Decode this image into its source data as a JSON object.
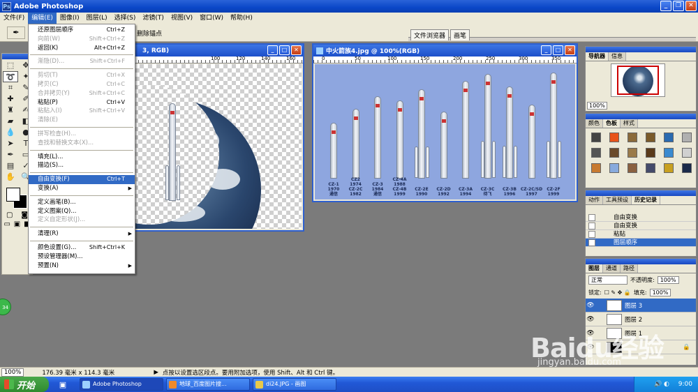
{
  "app": {
    "title": "Adobe Photoshop"
  },
  "menubar": [
    "文件(F)",
    "编辑(E)",
    "图像(I)",
    "图层(L)",
    "选择(S)",
    "滤镜(T)",
    "视图(V)",
    "窗口(W)",
    "帮助(H)"
  ],
  "options": {
    "text": "删除锚点",
    "wells": [
      "文件浏览器",
      "画笔"
    ]
  },
  "edit_menu": [
    {
      "label": "还原图层顺序",
      "shortcut": "Ctrl+Z",
      "state": "normal"
    },
    {
      "label": "向前(W)",
      "shortcut": "Shift+Ctrl+Z",
      "state": "disabled"
    },
    {
      "label": "返回(K)",
      "shortcut": "Alt+Ctrl+Z",
      "state": "normal"
    },
    {
      "label": "---"
    },
    {
      "label": "渐隐(D)...",
      "shortcut": "Shift+Ctrl+F",
      "state": "disabled"
    },
    {
      "label": "---"
    },
    {
      "label": "剪切(T)",
      "shortcut": "Ctrl+X",
      "state": "disabled"
    },
    {
      "label": "拷贝(C)",
      "shortcut": "Ctrl+C",
      "state": "disabled"
    },
    {
      "label": "合并拷贝(Y)",
      "shortcut": "Shift+Ctrl+C",
      "state": "disabled"
    },
    {
      "label": "粘贴(P)",
      "shortcut": "Ctrl+V",
      "state": "normal"
    },
    {
      "label": "粘贴入(I)",
      "shortcut": "Shift+Ctrl+V",
      "state": "disabled"
    },
    {
      "label": "清除(E)",
      "shortcut": "",
      "state": "disabled"
    },
    {
      "label": "---"
    },
    {
      "label": "拼写检查(H)...",
      "shortcut": "",
      "state": "disabled"
    },
    {
      "label": "查找和替换文本(X)...",
      "shortcut": "",
      "state": "disabled"
    },
    {
      "label": "---"
    },
    {
      "label": "填充(L)...",
      "shortcut": "",
      "state": "normal"
    },
    {
      "label": "描边(S)...",
      "shortcut": "",
      "state": "normal"
    },
    {
      "label": "---"
    },
    {
      "label": "自由变换(F)",
      "shortcut": "Ctrl+T",
      "state": "highlighted"
    },
    {
      "label": "变换(A)",
      "shortcut": "",
      "state": "normal",
      "submenu": true
    },
    {
      "label": "---"
    },
    {
      "label": "定义画笔(B)...",
      "shortcut": "",
      "state": "normal"
    },
    {
      "label": "定义图案(Q)...",
      "shortcut": "",
      "state": "normal"
    },
    {
      "label": "定义自定形状(J)...",
      "shortcut": "",
      "state": "disabled"
    },
    {
      "label": "---"
    },
    {
      "label": "清理(R)",
      "shortcut": "",
      "state": "normal",
      "submenu": true
    },
    {
      "label": "---"
    },
    {
      "label": "颜色设置(G)...",
      "shortcut": "Shift+Ctrl+K",
      "state": "normal"
    },
    {
      "label": "预设管理器(M)...",
      "shortcut": "",
      "state": "normal"
    },
    {
      "label": "预置(N)",
      "shortcut": "",
      "state": "normal",
      "submenu": true
    }
  ],
  "doc1": {
    "title": "3, RGB)",
    "ruler": [
      "100",
      "120",
      "140",
      "160"
    ]
  },
  "doc2": {
    "title": "中火箭族4.jpg @ 100%(RGB)",
    "ruler": [
      "0",
      "50",
      "100",
      "150",
      "200",
      "250",
      "300",
      "350"
    ],
    "rockets": [
      {
        "label": "CZ-1\n1970\n通信"
      },
      {
        "label": "CZ2\n1974\nCZ-2C\n1982"
      },
      {
        "label": "CZ-3\n1984\n通信"
      },
      {
        "label": "CZ-4A\n1988\nCZ-4B\n1999"
      },
      {
        "label": "CZ-2E\n1990"
      },
      {
        "label": "CZ-2D\n1992"
      },
      {
        "label": "CZ-3A\n1994"
      },
      {
        "label": "CZ-3C\n待飞"
      },
      {
        "label": "CZ-3B\n1996"
      },
      {
        "label": "CZ-2C/SD\n1997"
      },
      {
        "label": "CZ-2F\n1999"
      }
    ]
  },
  "navigator": {
    "tabs": [
      "导航器",
      "信息"
    ],
    "zoom": "100%"
  },
  "swatches": {
    "tabs": [
      "颜色",
      "色板",
      "样式"
    ],
    "colors": [
      "#444444",
      "#e8531a",
      "#8a6a3a",
      "#7a5a2a",
      "#2a6ab0",
      "#b0b0b0",
      "#555555",
      "#6b4a2a",
      "#9a7a4a",
      "#5a3a1a",
      "#3a8ad0",
      "#d0d0d0",
      "#c87a30",
      "#88aadd",
      "#8a6040",
      "#444a6a",
      "#c8a020",
      "#1a2a4a"
    ]
  },
  "history": {
    "tabs": [
      "动作",
      "工具预设",
      "历史记录"
    ],
    "items": [
      "自由变换",
      "自由变换",
      "粘贴",
      "图层顺序"
    ]
  },
  "layers": {
    "tabs": [
      "图层",
      "通道",
      "路径"
    ],
    "mode": "正常",
    "opacity_label": "不透明度:",
    "opacity": "100%",
    "lock_label": "锁定:",
    "fill_label": "填充:",
    "fill": "100%",
    "items": [
      "图层 3",
      "图层 2",
      "图层 1"
    ]
  },
  "status": {
    "zoom": "100%",
    "size": "176.39 毫米 x 114.3 毫米",
    "hint": "点按以设置选区段点。要用附加选项，使用 Shift、Alt 和 Ctrl 键。"
  },
  "taskbar": {
    "start": "开始",
    "tasks": [
      "Adobe Photoshop",
      "地球_百度图片搜...",
      "di24.JPG - 画图"
    ],
    "time": "9:00"
  },
  "watermark": {
    "main": "Baidu经验",
    "sub": "jingyan.baidu.com"
  },
  "greenball": "34"
}
